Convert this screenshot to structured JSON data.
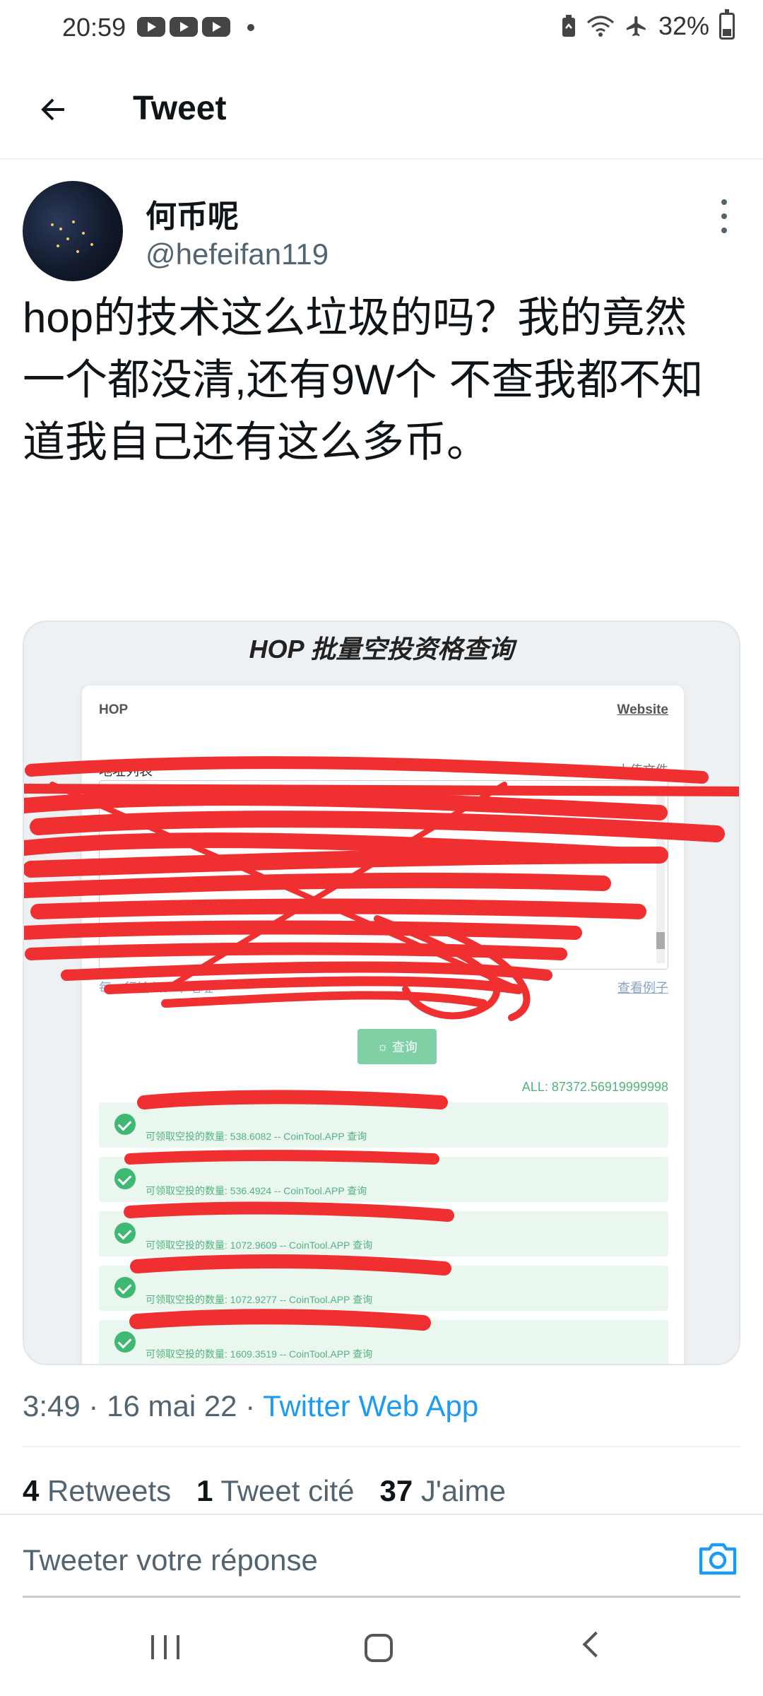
{
  "status_bar": {
    "time": "20:59",
    "battery": "32%",
    "icons": [
      "youtube-icon",
      "youtube-icon",
      "youtube-icon",
      "dot-icon",
      "battery-saver-icon",
      "wifi-icon",
      "airplane-icon",
      "battery-icon"
    ]
  },
  "header": {
    "title": "Tweet",
    "back_icon": "arrow-left-icon"
  },
  "tweet": {
    "author": {
      "name": "何币呢",
      "handle": "@hefeifan119"
    },
    "text_lines": [
      "hop的技术这么垃圾的吗？我的竟然",
      "一个都没清,还有9W个 不查我都不知",
      "道我自己还有这么多币。"
    ],
    "media": {
      "title": "HOP 批量空投资格查询",
      "card": {
        "brand": "HOP",
        "website": "Website",
        "address_label": "地址列表",
        "upload_label": "上传文件",
        "hint": "每一行输入一个地址",
        "example": "查看例子",
        "query_button": "查询",
        "all_total": "ALL: 87372.56919999998",
        "results": [
          "可领取空投的数量: 538.6082 -- CoinTool.APP 查询",
          "可领取空投的数量: 536.4924 -- CoinTool.APP 查询",
          "可领取空投的数量: 1072.9609 -- CoinTool.APP 查询",
          "可领取空投的数量: 1072.9277 -- CoinTool.APP 查询",
          "可领取空投的数量: 1609.3519 -- CoinTool.APP 查询"
        ]
      }
    },
    "meta": {
      "time": "3:49",
      "date": "16 mai 22",
      "source": "Twitter Web App",
      "separator": "·"
    },
    "stats": {
      "retweets_count": "4",
      "retweets_label": "Retweets",
      "quotes_count": "1",
      "quotes_label": "Tweet cité",
      "likes_count": "37",
      "likes_label": "J'aime"
    }
  },
  "reply": {
    "placeholder": "Tweeter votre réponse",
    "camera_icon": "camera-icon"
  },
  "colors": {
    "accent": "#1d9bf0",
    "text_primary": "#0f1419",
    "text_secondary": "#536471",
    "scribble_red": "#f03030",
    "success_green": "#52b37e"
  }
}
